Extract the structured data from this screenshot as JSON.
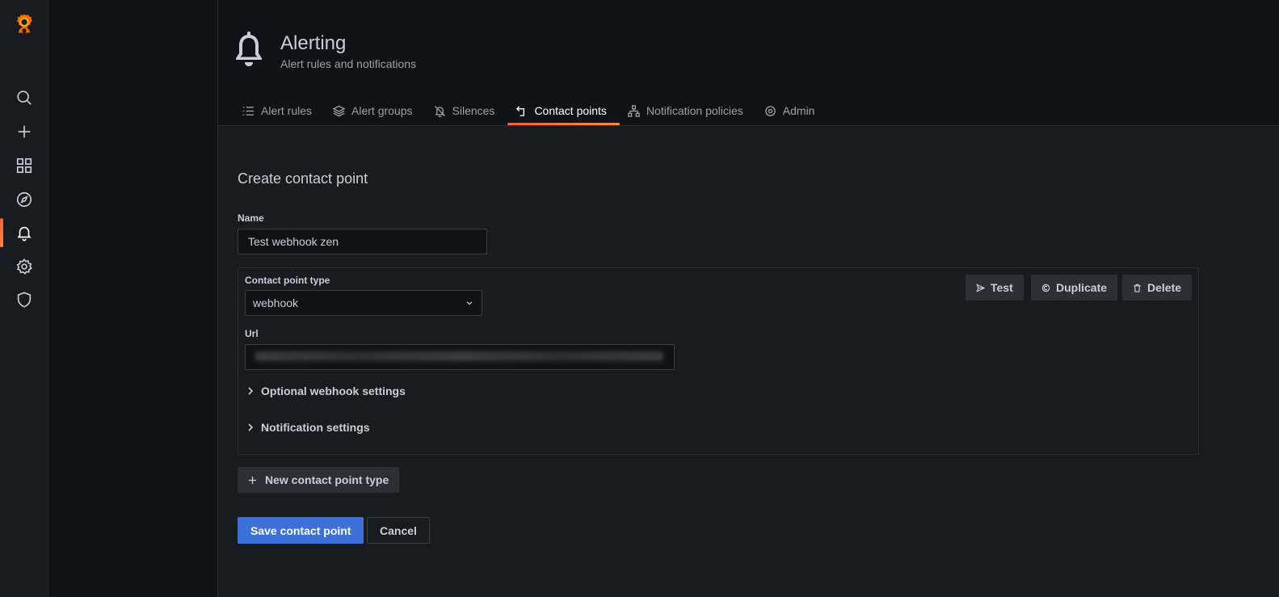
{
  "sidemenu": {
    "items": [
      {
        "name": "search",
        "icon": "search-icon"
      },
      {
        "name": "create",
        "icon": "plus-icon"
      },
      {
        "name": "dashboards",
        "icon": "apps-icon"
      },
      {
        "name": "explore",
        "icon": "compass-icon"
      },
      {
        "name": "alerting",
        "icon": "bell-icon",
        "active": true
      },
      {
        "name": "configuration",
        "icon": "cog-icon"
      },
      {
        "name": "server-admin",
        "icon": "shield-icon"
      }
    ]
  },
  "header": {
    "title": "Alerting",
    "subtitle": "Alert rules and notifications",
    "icon": "bell-icon"
  },
  "tabs": [
    {
      "label": "Alert rules",
      "icon": "list-icon"
    },
    {
      "label": "Alert groups",
      "icon": "layers-icon"
    },
    {
      "label": "Silences",
      "icon": "bell-slash-icon"
    },
    {
      "label": "Contact points",
      "icon": "contact-icon",
      "active": true
    },
    {
      "label": "Notification policies",
      "icon": "sitemap-icon"
    },
    {
      "label": "Admin",
      "icon": "cog-icon"
    }
  ],
  "form": {
    "title": "Create contact point",
    "name_label": "Name",
    "name_value": "Test webhook zen",
    "receiver": {
      "type_label": "Contact point type",
      "type_value": "webhook",
      "url_label": "Url",
      "test_label": "Test",
      "duplicate_label": "Duplicate",
      "delete_label": "Delete",
      "optional_settings_label": "Optional webhook settings",
      "notification_settings_label": "Notification settings"
    },
    "new_type_label": "New contact point type",
    "save_label": "Save contact point",
    "cancel_label": "Cancel"
  },
  "colors": {
    "accent": "#f55f3e",
    "primary": "#3d71d9",
    "background": "#111217",
    "panel": "#181b1f"
  }
}
